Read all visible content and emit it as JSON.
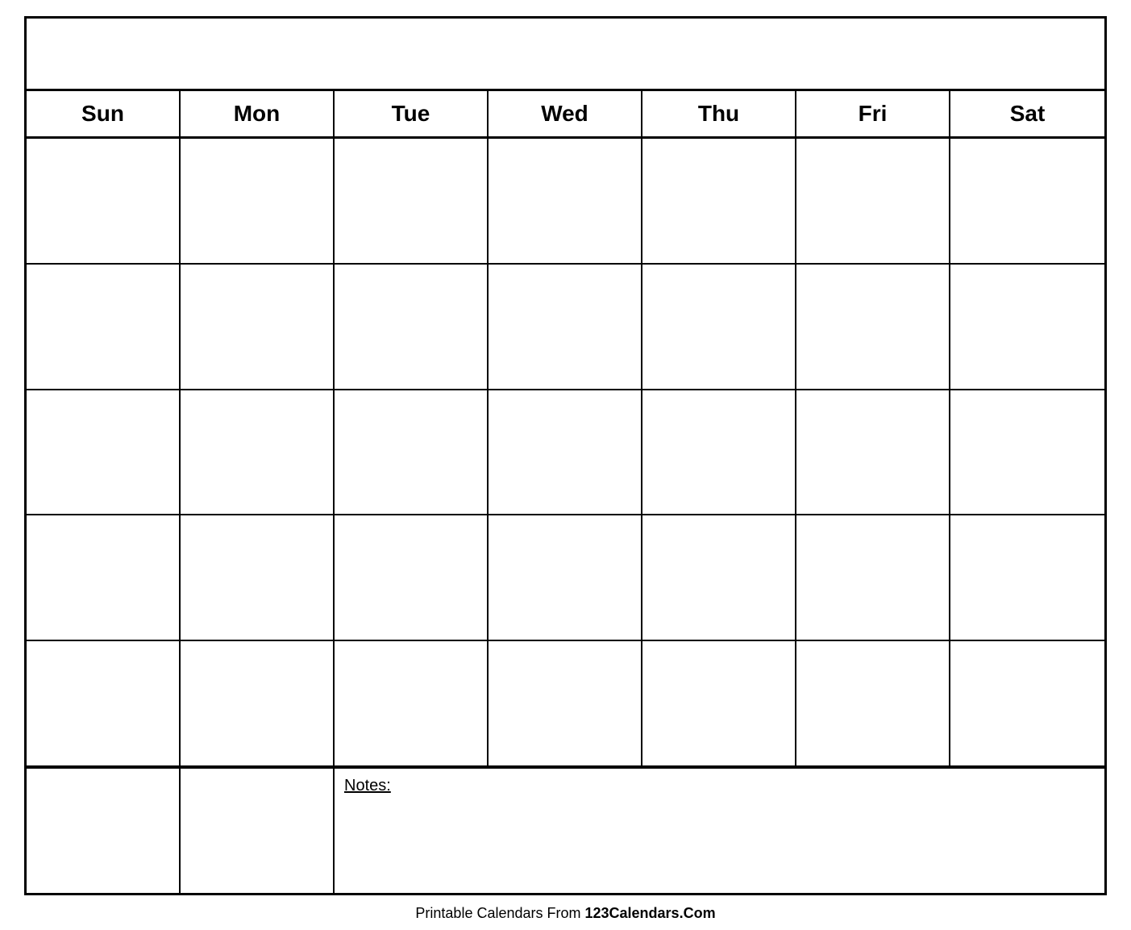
{
  "calendar": {
    "title": "",
    "days": [
      "Sun",
      "Mon",
      "Tue",
      "Wed",
      "Thu",
      "Fri",
      "Sat"
    ],
    "rows": 5,
    "notes_label": "Notes:"
  },
  "footer": {
    "text_normal": "Printable Calendars From ",
    "text_bold": "123Calendars.Com"
  }
}
